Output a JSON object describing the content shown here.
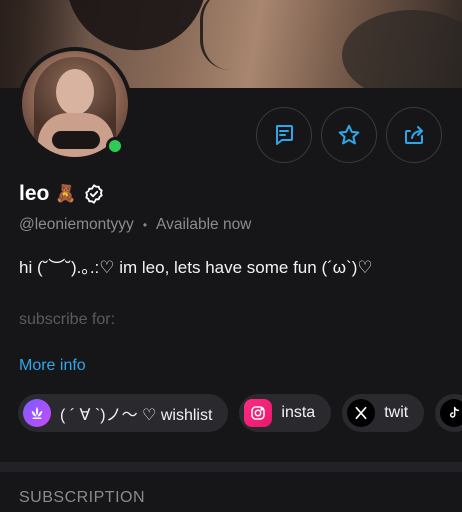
{
  "profile": {
    "name": "leo",
    "name_emoji": "🧸",
    "handle": "@leoniemontyyy",
    "status": "Available now",
    "bio": "hi (˘︶˘).｡.:♡ im leo, lets have some fun (´ω`)♡",
    "bio_more": "subscribe for:",
    "more_info_label": "More info",
    "online": true
  },
  "actions": [
    {
      "name": "message",
      "icon": "message-icon"
    },
    {
      "name": "favorite",
      "icon": "star-icon"
    },
    {
      "name": "share",
      "icon": "share-icon"
    }
  ],
  "links": [
    {
      "label": "( ´ ∀ `)ノ～ ♡ wishlist",
      "icon": "wishlist-icon"
    },
    {
      "label": "insta",
      "icon": "instagram-icon"
    },
    {
      "label": "twit",
      "icon": "x-icon"
    },
    {
      "label": "",
      "icon": "tiktok-icon"
    }
  ],
  "sections": {
    "subscription_title": "SUBSCRIPTION"
  },
  "colors": {
    "background": "#161618",
    "accent": "#2ea6e8",
    "online": "#2ecc55",
    "chip": "#2a2a2e"
  }
}
